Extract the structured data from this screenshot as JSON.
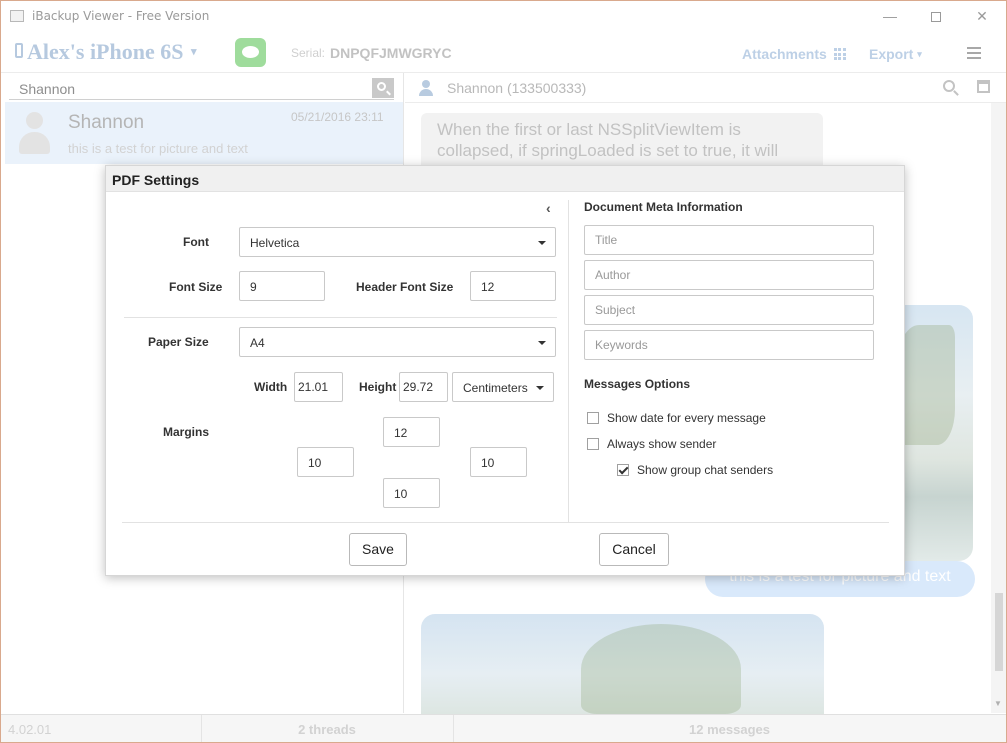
{
  "window": {
    "title": "iBackup Viewer - Free Version",
    "minimize": "—",
    "close": "✕"
  },
  "toolbar": {
    "device_name": "Alex's iPhone 6S",
    "device_caret": "▾",
    "serial_label": "Serial:",
    "serial_value": "DNPQFJMWGRYC",
    "attachments_label": "Attachments",
    "export_label": "Export",
    "export_caret": "▾"
  },
  "threads": {
    "search_value": "Shannon",
    "items": [
      {
        "name": "Shannon",
        "date": "05/21/2016 23:11",
        "preview": "this is a test for picture and text"
      }
    ]
  },
  "conversation": {
    "title": "Shannon (133500333)",
    "message_text": "When the first or last NSSplitViewItem is collapsed, if springLoaded is set to true, it will",
    "sent_text": "this is a test for picture and text"
  },
  "statusbar": {
    "version": "4.02.01",
    "threads": "2 threads",
    "messages": "12 messages"
  },
  "dialog": {
    "title": "PDF Settings",
    "collapse_icon": "‹",
    "font_label": "Font",
    "font_value": "Helvetica",
    "font_size_label": "Font Size",
    "font_size_value": "9",
    "header_font_size_label": "Header Font Size",
    "header_font_size_value": "12",
    "paper_size_label": "Paper Size",
    "paper_size_value": "A4",
    "width_label": "Width",
    "width_value": "21.01",
    "height_label": "Height",
    "height_value": "29.72",
    "unit_value": "Centimeters",
    "margins_label": "Margins",
    "margin_top": "12",
    "margin_left": "10",
    "margin_right": "10",
    "margin_bottom": "10",
    "meta_title": "Document Meta Information",
    "meta_fields": {
      "title_placeholder": "Title",
      "author_placeholder": "Author",
      "subject_placeholder": "Subject",
      "keywords_placeholder": "Keywords"
    },
    "options_title": "Messages Options",
    "options": [
      {
        "label": "Show date for every message",
        "checked": false
      },
      {
        "label": "Always show sender",
        "checked": false
      },
      {
        "label": "Show group chat senders",
        "checked": true
      }
    ],
    "save_label": "Save",
    "cancel_label": "Cancel"
  }
}
